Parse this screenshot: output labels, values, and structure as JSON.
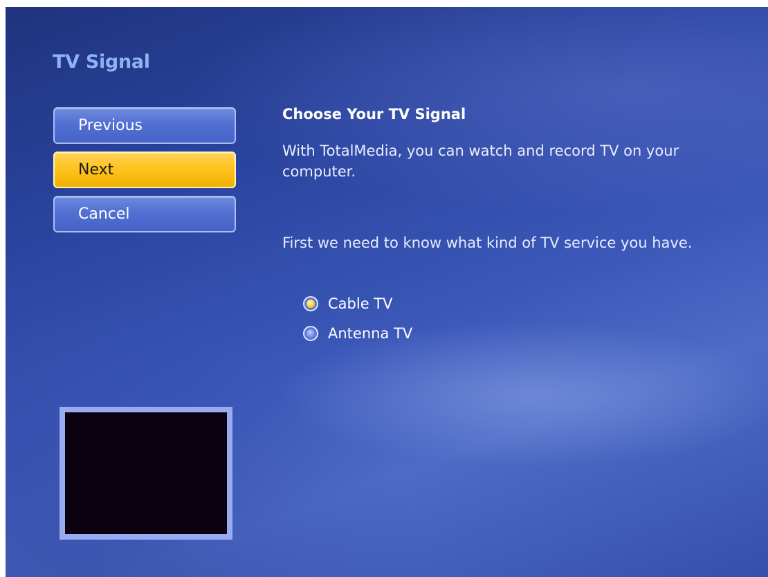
{
  "page": {
    "title": "TV Signal"
  },
  "nav": {
    "previous_label": "Previous",
    "next_label": "Next",
    "cancel_label": "Cancel",
    "focused": "Next"
  },
  "content": {
    "heading": "Choose Your TV Signal",
    "intro": "With TotalMedia, you can watch and record TV on your computer.",
    "question": "First we need to know what kind of TV service you have."
  },
  "options": [
    {
      "label": "Cable TV",
      "selected": true
    },
    {
      "label": "Antenna TV",
      "selected": false
    }
  ],
  "colors": {
    "background": "#3350aa",
    "title": "#8fb2f4",
    "button": "#5270d2",
    "button_focused": "#ffc31e",
    "preview_border": "#97acf0",
    "preview_fill": "#0b0010"
  }
}
